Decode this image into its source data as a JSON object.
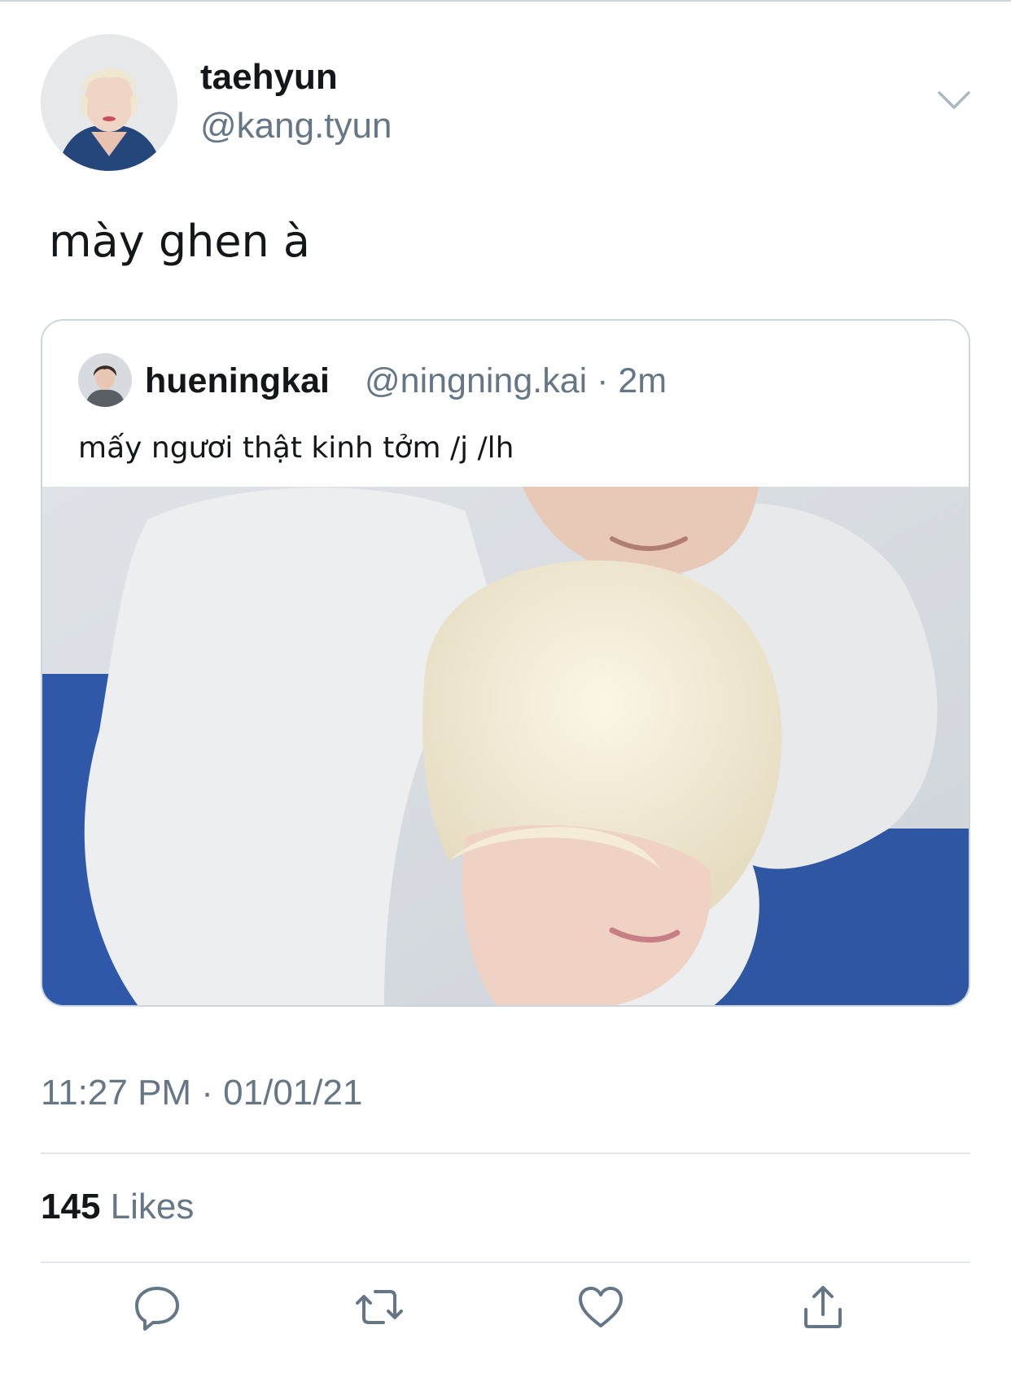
{
  "tweet": {
    "display_name": "taehyun",
    "handle": "@kang.tyun",
    "text": "mày ghen à",
    "timestamp": "11:27 PM · 01/01/21",
    "likes_count": "145",
    "likes_label": "Likes"
  },
  "quoted": {
    "display_name": "hueningkai",
    "handle_time": "@ningning.kai · 2m",
    "text": "mấy ngươi thật kinh tởm /j /lh"
  },
  "icons": {
    "menu": "chevron-down-icon",
    "reply": "reply-bubble-icon",
    "retweet": "retweet-icon",
    "like": "heart-icon",
    "share": "share-icon"
  },
  "colors": {
    "text": "#14171a",
    "secondary": "#657786",
    "border": "#ccd6dd",
    "divider": "#e1e8ed"
  }
}
